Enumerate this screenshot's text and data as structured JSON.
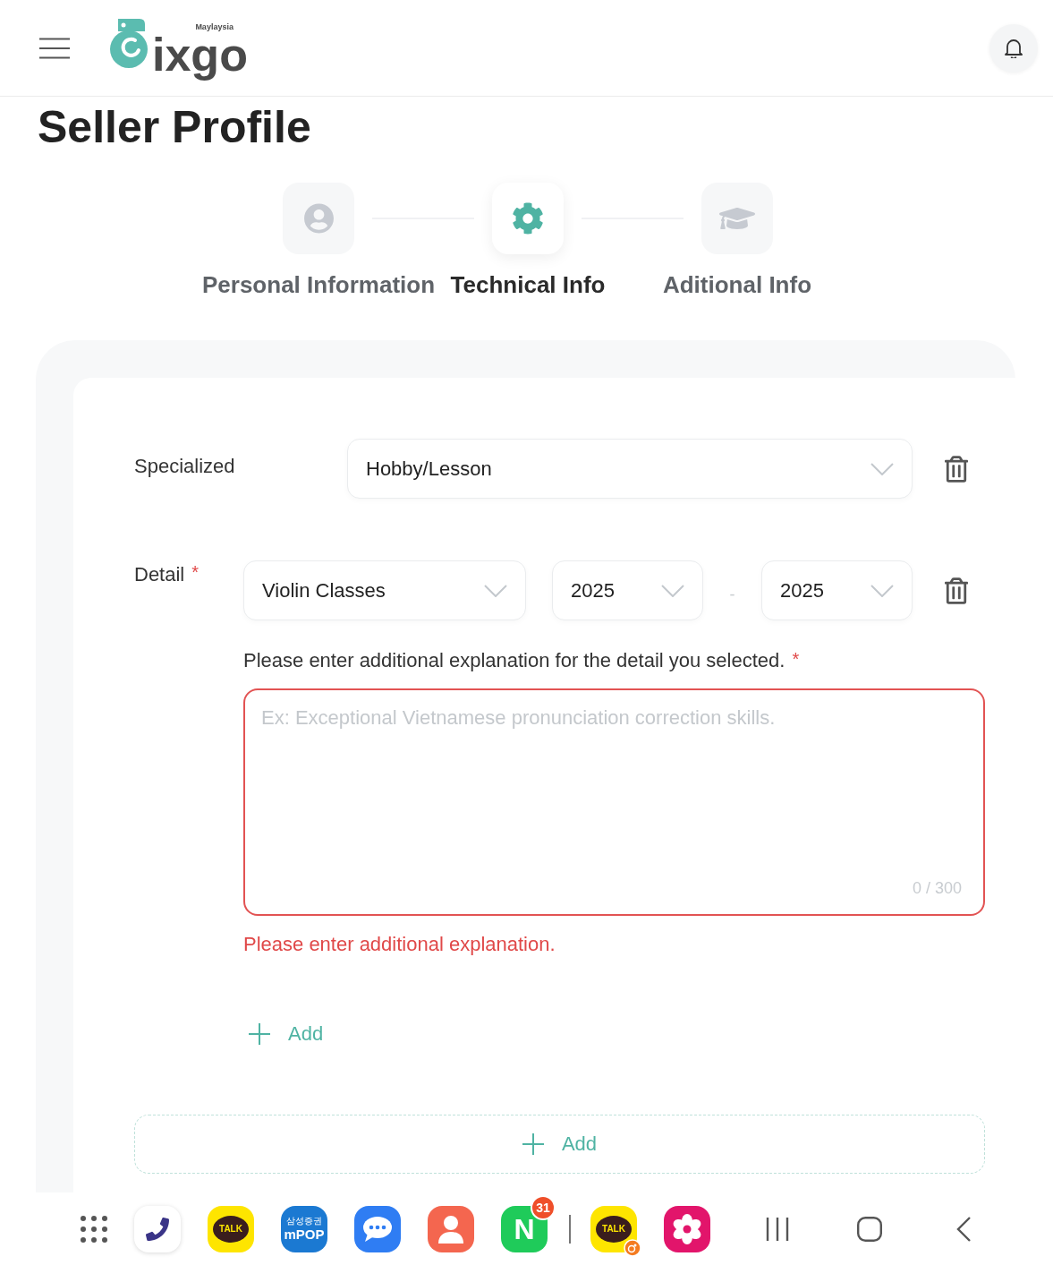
{
  "header": {
    "logo": {
      "name": "ixgo",
      "region": "Maylaysia"
    }
  },
  "title": "Seller Profile",
  "steps": [
    {
      "label": "Personal Information",
      "kind": "person",
      "selected": false
    },
    {
      "label": "Technical Info",
      "kind": "gear",
      "selected": true
    },
    {
      "label": "Aditional Info",
      "kind": "cap",
      "selected": false
    }
  ],
  "form": {
    "specialized": {
      "label": "Specialized",
      "value": "Hobby/Lesson"
    },
    "detail": {
      "label": "Detail",
      "required_mark": "*",
      "selects": [
        {
          "value": "Violin Classes"
        },
        {
          "value": "2025"
        },
        {
          "value": "2025"
        }
      ],
      "separator": "-"
    },
    "explanation": {
      "label": "Please enter additional explanation for the detail you selected.",
      "required_mark": "*",
      "placeholder": "Ex: Exceptional Vietnamese pronunciation correction skills.",
      "counter": "0 / 300",
      "invalid": true,
      "error": "Please enter additional explanation."
    },
    "add_detail": {
      "label": "Add"
    },
    "add_specialized": {
      "label": "Add"
    }
  },
  "taskbar": {
    "apps": [
      {
        "kind": "grid"
      },
      {
        "kind": "phone"
      },
      {
        "kind": "talk",
        "label": "TALK"
      },
      {
        "kind": "pop",
        "label": "mPOP",
        "caption": "삼성증권"
      },
      {
        "kind": "chat"
      },
      {
        "kind": "contacts"
      },
      {
        "kind": "letter",
        "label": "N",
        "badge": "31"
      }
    ],
    "recent_apps": [
      {
        "kind": "talk",
        "label": "TALK",
        "overlay": true
      },
      {
        "kind": "flower"
      }
    ],
    "nav": [
      {
        "kind": "recents"
      },
      {
        "kind": "home"
      },
      {
        "kind": "back"
      }
    ]
  }
}
